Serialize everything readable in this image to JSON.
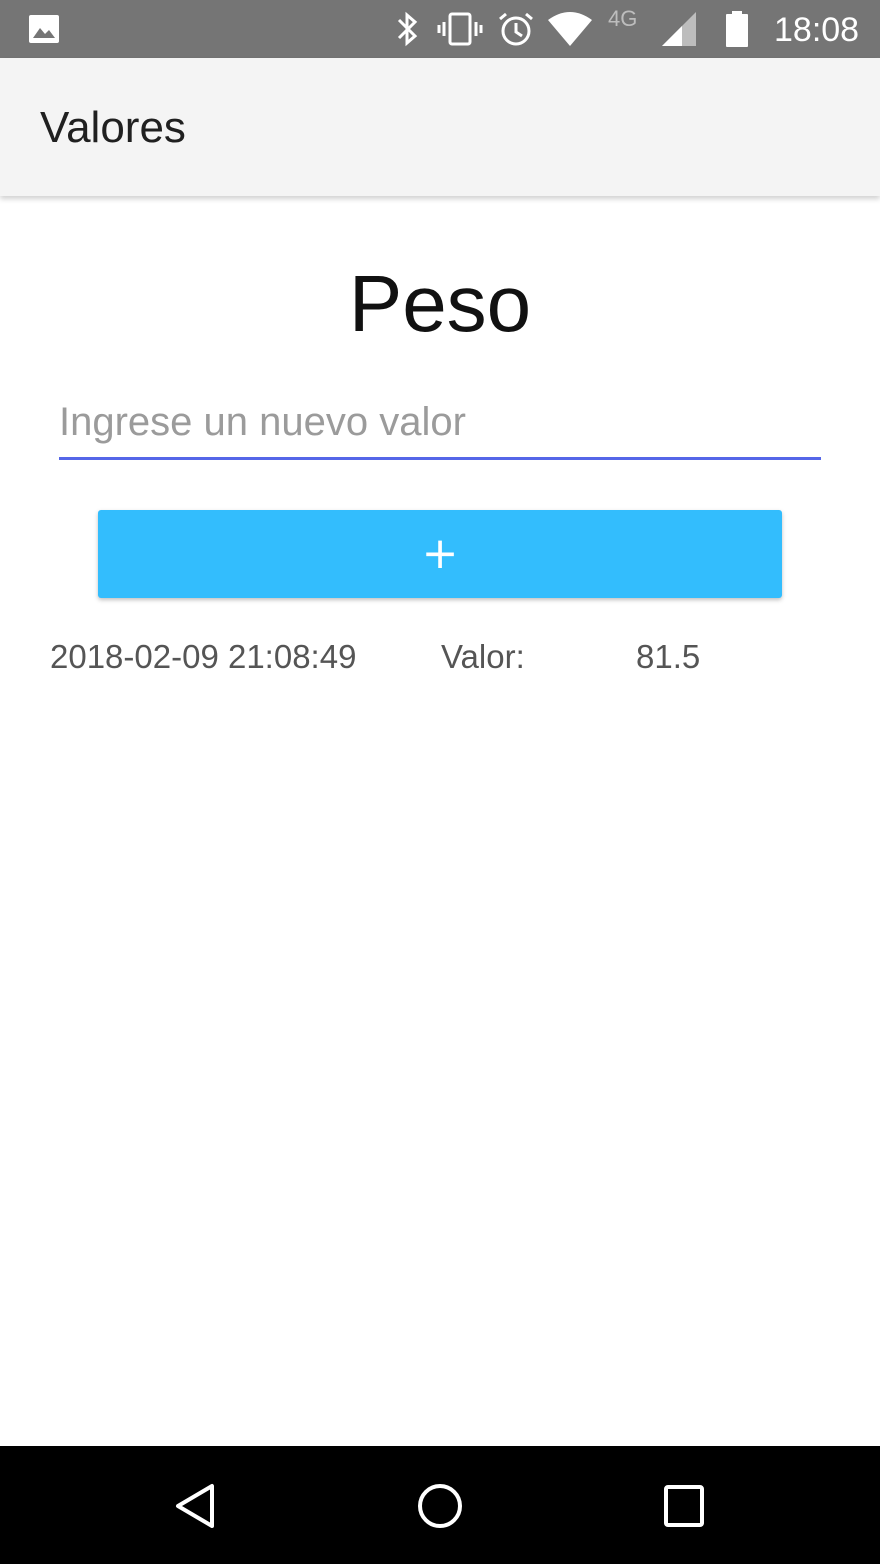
{
  "status_bar": {
    "time": "18:08",
    "network_label": "4G",
    "icons": [
      "image-icon",
      "bluetooth-icon",
      "vibrate-icon",
      "alarm-icon",
      "wifi-icon",
      "signal-icon",
      "battery-icon"
    ]
  },
  "app_bar": {
    "title": "Valores"
  },
  "main": {
    "heading": "Peso",
    "input": {
      "placeholder": "Ingrese un nuevo valor",
      "value": ""
    },
    "add_button_label": "+",
    "accent_color": "#33bdfd",
    "input_underline_color": "#5566e8",
    "entries": [
      {
        "date": "2018-02-09 21:08:49",
        "label": "Valor:",
        "value": "81.5"
      }
    ]
  },
  "nav_bar": {
    "buttons": [
      "back-icon",
      "home-icon",
      "recents-icon"
    ]
  }
}
